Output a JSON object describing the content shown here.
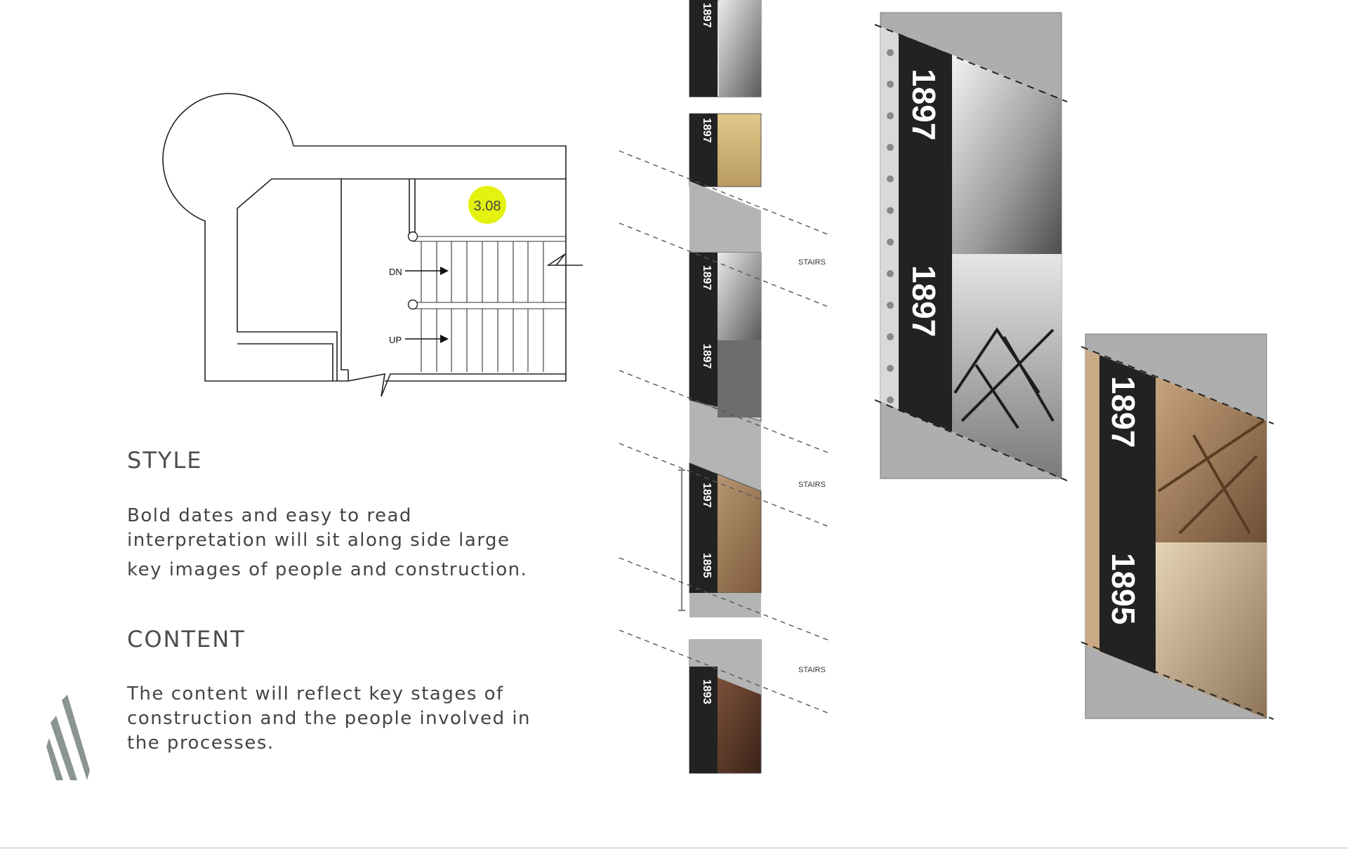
{
  "plan": {
    "room_number": "3.08",
    "dn_label": "DN",
    "up_label": "UP",
    "accent_color": "#e3f20f"
  },
  "style_section": {
    "heading": "STYLE",
    "lines": [
      "Bold dates and easy to read",
      "interpretation will sit along side large",
      "key images of people and construction."
    ]
  },
  "content_section": {
    "heading": "CONTENT",
    "lines": [
      "The content will reflect key stages of",
      "construction and the people involved in",
      "the processes."
    ]
  },
  "elevation": {
    "stairs_labels": [
      "STAIRS",
      "STAIRS",
      "STAIRS"
    ],
    "panel_years": [
      "1897",
      "1897",
      "1897",
      "1897",
      "1897",
      "1895",
      "1893"
    ]
  },
  "detail_panels": {
    "panel_a_years": [
      "1897",
      "1897"
    ],
    "panel_b_years": [
      "1897",
      "1895"
    ]
  },
  "colors": {
    "panel_dark": "#222222",
    "panel_grey": "#aeaeae",
    "sepia": "#a88461",
    "logo": "#8a9493"
  }
}
